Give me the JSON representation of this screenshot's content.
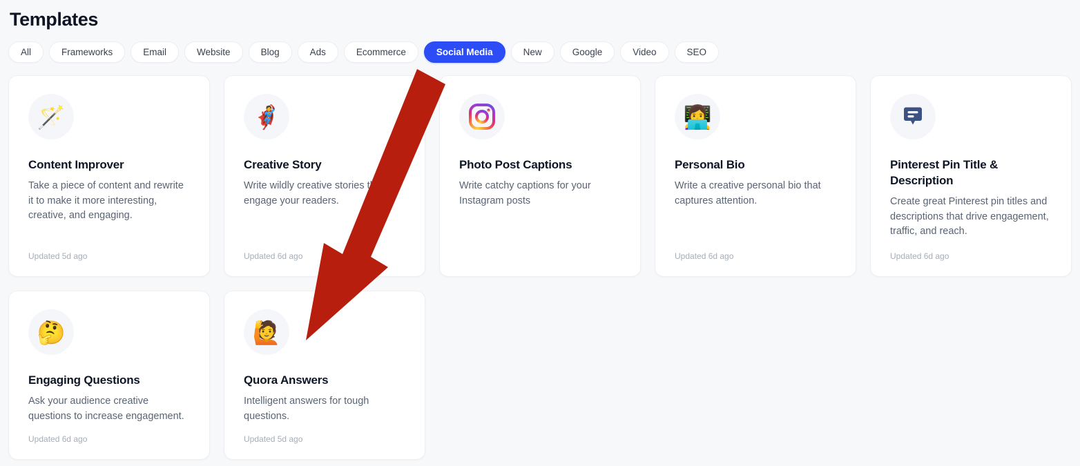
{
  "header": {
    "title": "Templates"
  },
  "filters": {
    "items": [
      {
        "label": "All",
        "active": false
      },
      {
        "label": "Frameworks",
        "active": false
      },
      {
        "label": "Email",
        "active": false
      },
      {
        "label": "Website",
        "active": false
      },
      {
        "label": "Blog",
        "active": false
      },
      {
        "label": "Ads",
        "active": false
      },
      {
        "label": "Ecommerce",
        "active": false
      },
      {
        "label": "Social Media",
        "active": true
      },
      {
        "label": "New",
        "active": false
      },
      {
        "label": "Google",
        "active": false
      },
      {
        "label": "Video",
        "active": false
      },
      {
        "label": "SEO",
        "active": false
      }
    ],
    "active_label": "Social Media",
    "active_color": "#2c4cf5"
  },
  "cards": [
    {
      "title": "Content Improver",
      "description": "Take a piece of content and rewrite it to make it more interesting, creative, and engaging.",
      "updated": "Updated 5d ago",
      "icon": "magic-wand-icon",
      "emoji": "🪄"
    },
    {
      "title": "Creative Story",
      "description": "Write wildly creative stories that engage your readers.",
      "updated": "Updated 6d ago",
      "icon": "superhero-icon",
      "emoji": "🦸"
    },
    {
      "title": "Photo Post Captions",
      "description": "Write catchy captions for your Instagram posts",
      "updated": "",
      "icon": "instagram-icon",
      "emoji": ""
    },
    {
      "title": "Personal Bio",
      "description": "Write a creative personal bio that captures attention.",
      "updated": "Updated 6d ago",
      "icon": "woman-technologist-icon",
      "emoji": "👩‍💻"
    },
    {
      "title": "Pinterest Pin Title & Description",
      "description": "Create great Pinterest pin titles and descriptions that drive engagement, traffic, and reach.",
      "updated": "Updated 6d ago",
      "icon": "speech-bubble-icon",
      "emoji": ""
    },
    {
      "title": "Engaging Questions",
      "description": "Ask your audience creative questions to increase engagement.",
      "updated": "Updated 6d ago",
      "icon": "thinking-face-icon",
      "emoji": "🤔"
    },
    {
      "title": "Quora Answers",
      "description": "Intelligent answers for tough questions.",
      "updated": "Updated 5d ago",
      "icon": "person-raising-hand-icon",
      "emoji": "🙋"
    }
  ],
  "annotation": {
    "type": "arrow",
    "color": "#b81e0d",
    "points_from": "Social Media filter pill",
    "points_to": "Quora Answers card"
  },
  "theme": {
    "page_background": "#f7f8fa",
    "card_background": "#ffffff",
    "title_color": "#0e1626",
    "body_text_color": "#5a6474",
    "meta_text_color": "#a6adb9"
  }
}
